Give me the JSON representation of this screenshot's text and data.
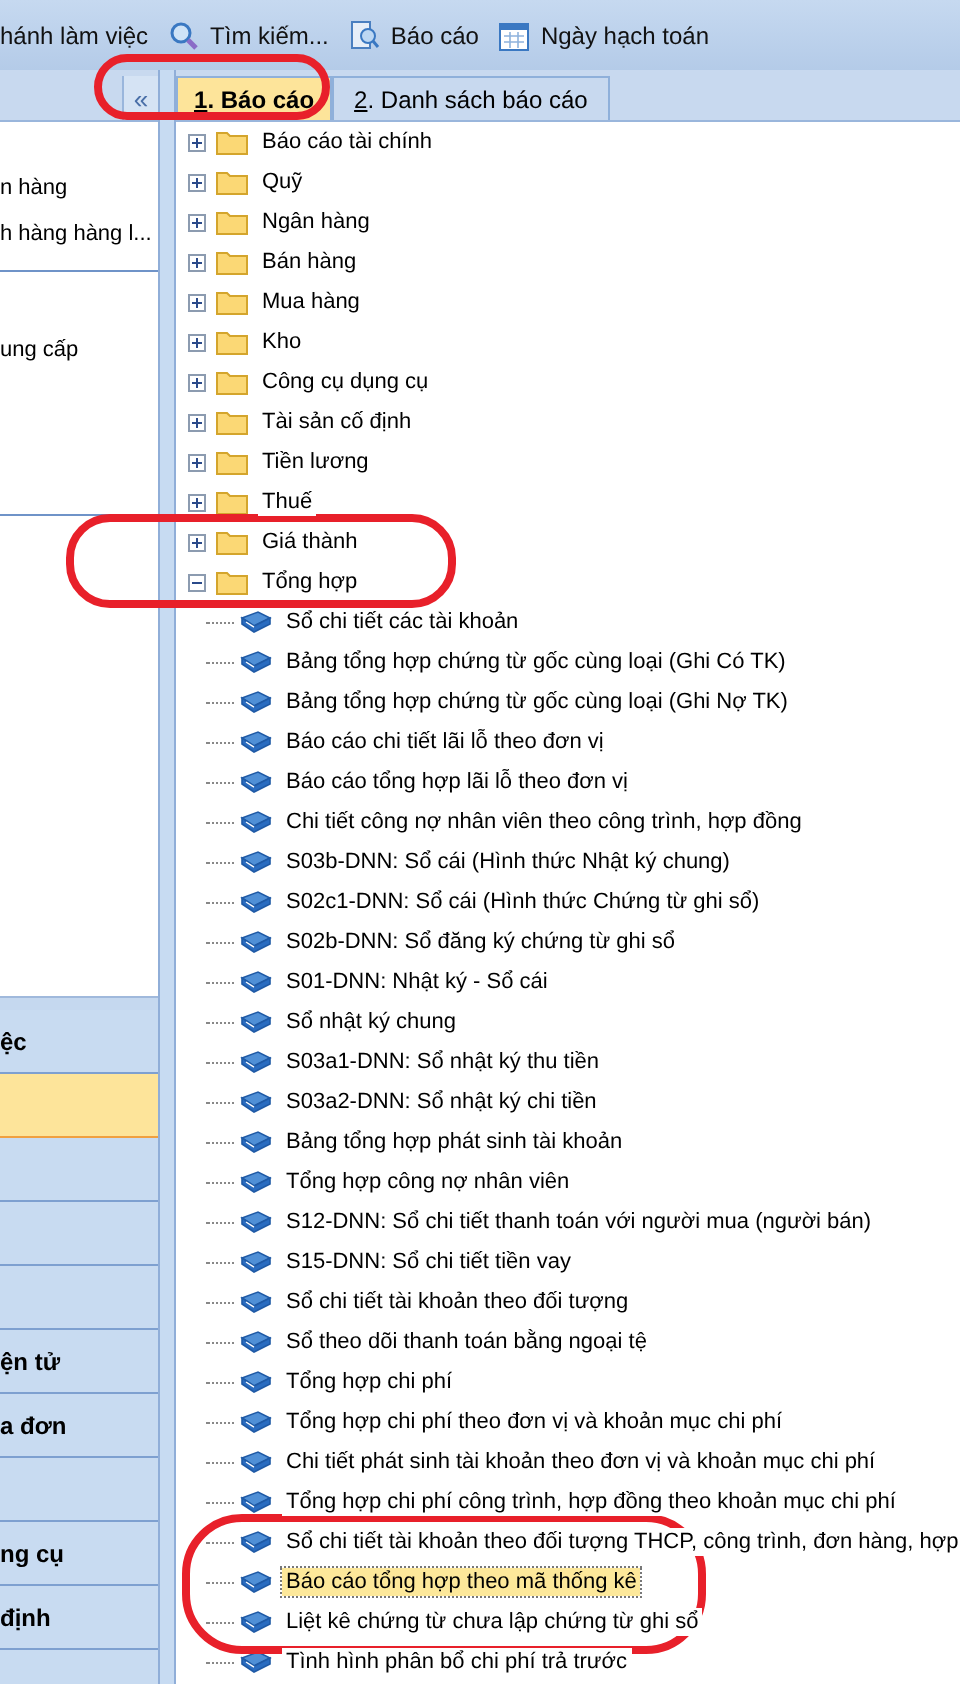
{
  "toolbar": {
    "items": [
      {
        "kind": "text",
        "label": "hánh làm việc"
      },
      {
        "kind": "search",
        "label": "Tìm kiếm..."
      },
      {
        "kind": "report",
        "label": "Báo cáo"
      },
      {
        "kind": "calendar",
        "label": "Ngày hạch toán"
      }
    ]
  },
  "left_panel": {
    "collapse_button": "«",
    "groups": [
      [
        "n hàng",
        "h hàng hàng l..."
      ],
      [
        "ung cấp"
      ]
    ],
    "nav_buttons": [
      {
        "label": "ệc",
        "selected": false
      },
      {
        "selected": true
      },
      {
        "selected": false
      },
      {
        "selected": false
      },
      {
        "selected": false
      },
      {
        "label": "ện tử",
        "selected": false
      },
      {
        "label": "a đơn",
        "selected": false
      },
      {
        "selected": false
      },
      {
        "label": "ng cụ",
        "selected": false
      },
      {
        "label": "định",
        "selected": false
      }
    ]
  },
  "tabs": [
    {
      "number": "1",
      "label": ". Báo cáo",
      "selected": true
    },
    {
      "number": "2",
      "label": ". Danh sách báo cáo",
      "selected": false
    }
  ],
  "tree": [
    {
      "label": "Báo cáo tài chính",
      "expanded": false
    },
    {
      "label": "Quỹ",
      "expanded": false
    },
    {
      "label": "Ngân hàng",
      "expanded": false
    },
    {
      "label": "Bán hàng",
      "expanded": false
    },
    {
      "label": "Mua hàng",
      "expanded": false
    },
    {
      "label": "Kho",
      "expanded": false
    },
    {
      "label": "Công cụ dụng cụ",
      "expanded": false
    },
    {
      "label": "Tài sản cố định",
      "expanded": false
    },
    {
      "label": "Tiền lương",
      "expanded": false
    },
    {
      "label": "Thuế",
      "expanded": false
    },
    {
      "label": "Giá thành",
      "expanded": false
    },
    {
      "label": "Tổng hợp",
      "expanded": true,
      "children": [
        {
          "label": "Sổ chi tiết các tài khoản",
          "selected": false
        },
        {
          "label": "Bảng tổng hợp chứng từ gốc cùng loại (Ghi Có TK)",
          "selected": false
        },
        {
          "label": "Bảng tổng hợp chứng từ gốc cùng loại (Ghi Nợ TK)",
          "selected": false
        },
        {
          "label": "Báo cáo chi tiết lãi lỗ theo đơn vị",
          "selected": false
        },
        {
          "label": "Báo cáo tổng hợp lãi lỗ theo đơn vị",
          "selected": false
        },
        {
          "label": "Chi tiết công nợ nhân viên theo công trình, hợp đồng",
          "selected": false
        },
        {
          "label": "S03b-DNN: Sổ cái (Hình thức Nhật ký chung)",
          "selected": false
        },
        {
          "label": "S02c1-DNN: Sổ cái (Hình thức Chứng từ ghi sổ)",
          "selected": false
        },
        {
          "label": "S02b-DNN: Sổ đăng ký chứng từ ghi sổ",
          "selected": false
        },
        {
          "label": "S01-DNN: Nhật ký - Sổ cái",
          "selected": false
        },
        {
          "label": "Sổ nhật ký chung",
          "selected": false
        },
        {
          "label": "S03a1-DNN: Sổ nhật ký thu tiền",
          "selected": false
        },
        {
          "label": "S03a2-DNN: Sổ nhật ký chi tiền",
          "selected": false
        },
        {
          "label": "Bảng tổng hợp phát sinh tài khoản",
          "selected": false
        },
        {
          "label": "Tổng hợp công nợ nhân viên",
          "selected": false
        },
        {
          "label": "S12-DNN: Sổ chi tiết thanh toán với người mua (người bán)",
          "selected": false
        },
        {
          "label": "S15-DNN: Sổ chi tiết tiền vay",
          "selected": false
        },
        {
          "label": "Sổ chi tiết tài khoản theo đối tượng",
          "selected": false
        },
        {
          "label": "Sổ theo dõi thanh toán bằng ngoại tệ",
          "selected": false
        },
        {
          "label": "Tổng hợp chi phí",
          "selected": false
        },
        {
          "label": "Tổng hợp chi phí theo đơn vị và khoản mục chi phí",
          "selected": false
        },
        {
          "label": "Chi tiết phát sinh tài khoản theo đơn vị và khoản mục chi phí",
          "selected": false
        },
        {
          "label": "Tổng hợp chi phí công trình, hợp đồng theo khoản mục chi phí",
          "selected": false
        },
        {
          "label": "Sổ chi tiết tài khoản theo đối tượng THCP, công trình, đơn hàng, hợp",
          "selected": false
        },
        {
          "label": "Báo cáo tổng hợp theo mã thống kê",
          "selected": true
        },
        {
          "label": "Liệt kê chứng từ chưa lập chứng từ ghi sổ",
          "selected": false
        },
        {
          "label": "Tình hình phân bổ chi phí trả trước",
          "selected": false
        }
      ]
    }
  ]
}
